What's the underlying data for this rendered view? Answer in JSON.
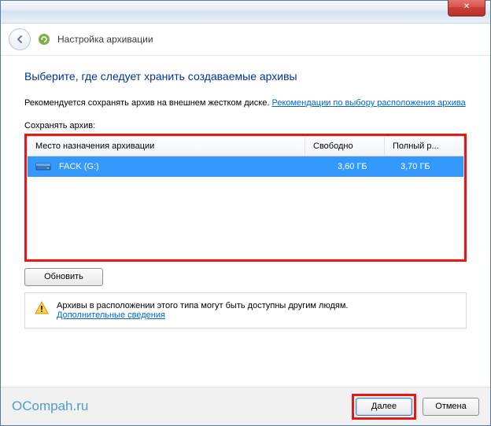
{
  "titlebar": {
    "close_glyph": "✕"
  },
  "header": {
    "title": "Настройка архивации"
  },
  "main": {
    "heading": "Выберите, где следует хранить создаваемые архивы",
    "description_prefix": "Рекомендуется сохранять архив на внешнем жестком диске. ",
    "description_link": "Рекомендации по выбору расположения архива",
    "save_label": "Сохранять архив:",
    "columns": {
      "c1": "Место назначения архивации",
      "c2": "Свободно",
      "c3": "Полный р..."
    },
    "rows": [
      {
        "name": "FACK (G:)",
        "free": "3,60 ГБ",
        "total": "3,70 ГБ",
        "selected": true
      }
    ],
    "refresh_label": "Обновить",
    "warning_text": "Архивы в расположении этого типа могут быть доступны другим людям.",
    "warning_link": "Дополнительные сведения"
  },
  "footer": {
    "watermark": "OCompah.ru",
    "next_label": "Далее",
    "cancel_label": "Отмена"
  }
}
